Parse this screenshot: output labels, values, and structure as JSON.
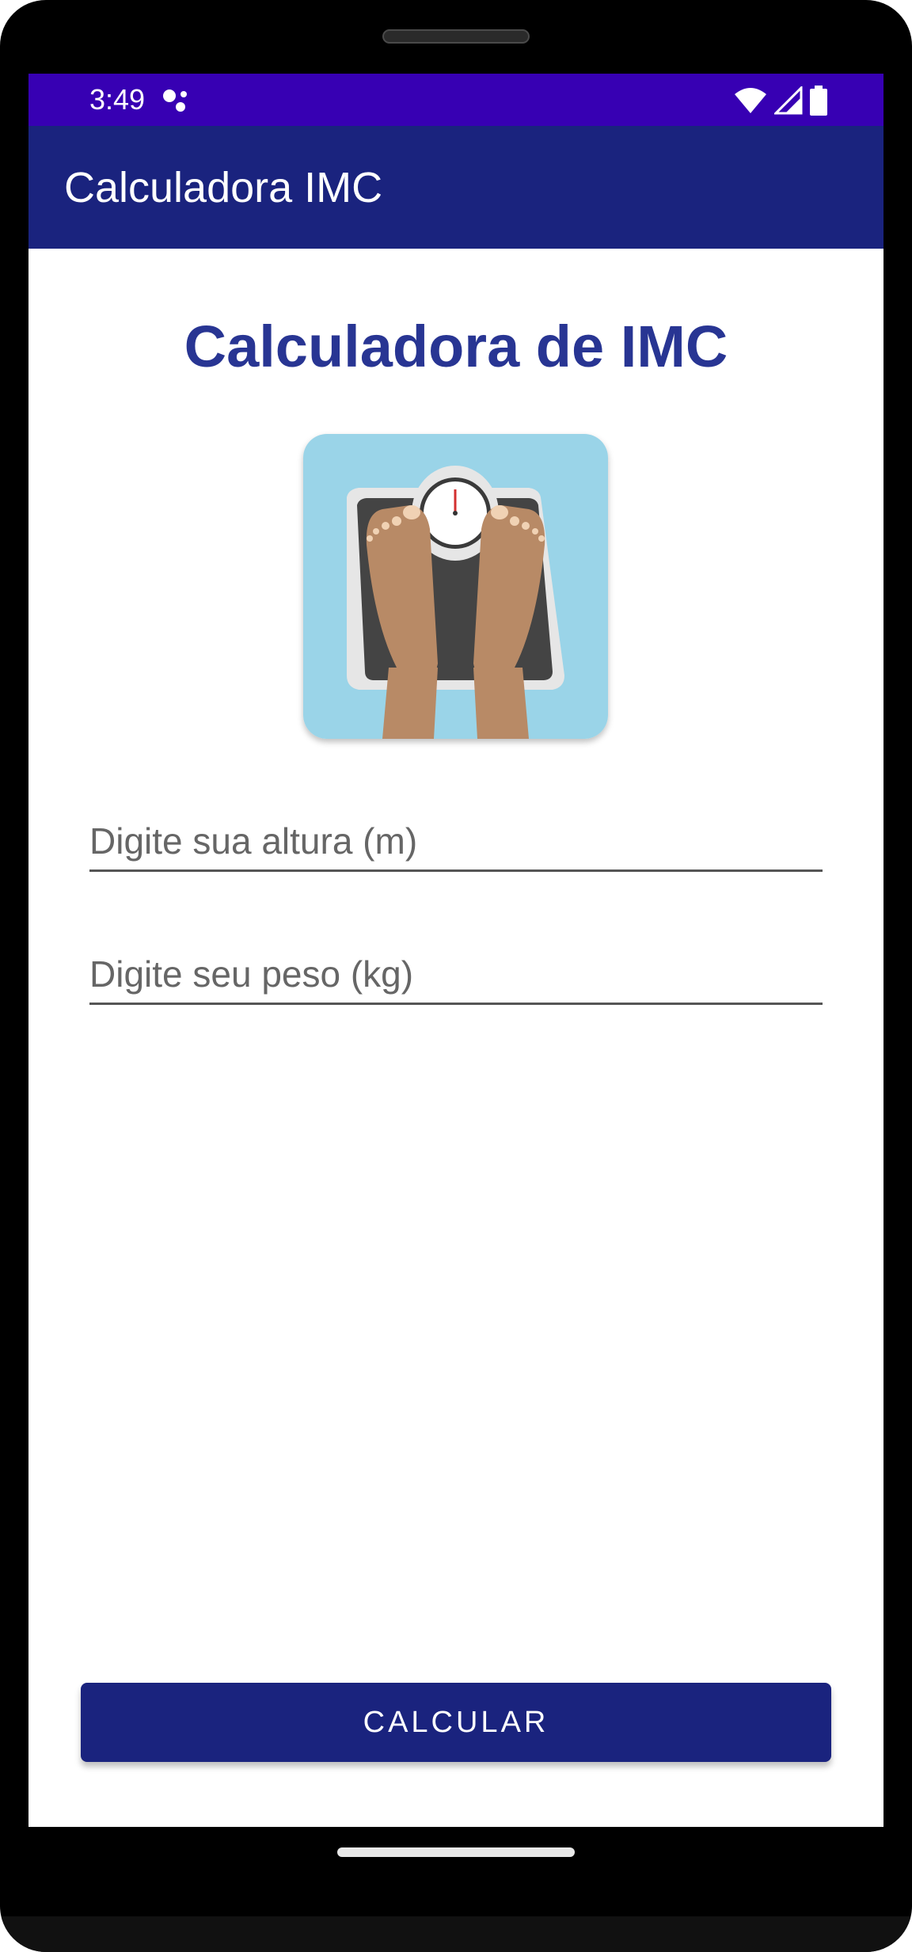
{
  "status_bar": {
    "time": "3:49",
    "icons": [
      "assistant-dots-icon",
      "wifi-icon",
      "signal-icon",
      "battery-icon"
    ],
    "background": "#3700b3"
  },
  "app_bar": {
    "title": "Calculadora IMC",
    "background": "#1a237e"
  },
  "main": {
    "heading": "Calculadora de IMC",
    "heading_color": "#283593",
    "image": "bathroom-scale-feet-icon",
    "height_input": {
      "placeholder": "Digite sua altura (m)",
      "value": ""
    },
    "weight_input": {
      "placeholder": "Digite seu peso (kg)",
      "value": ""
    },
    "calculate_button": {
      "label": "CALCULAR",
      "background": "#1a237e"
    }
  }
}
